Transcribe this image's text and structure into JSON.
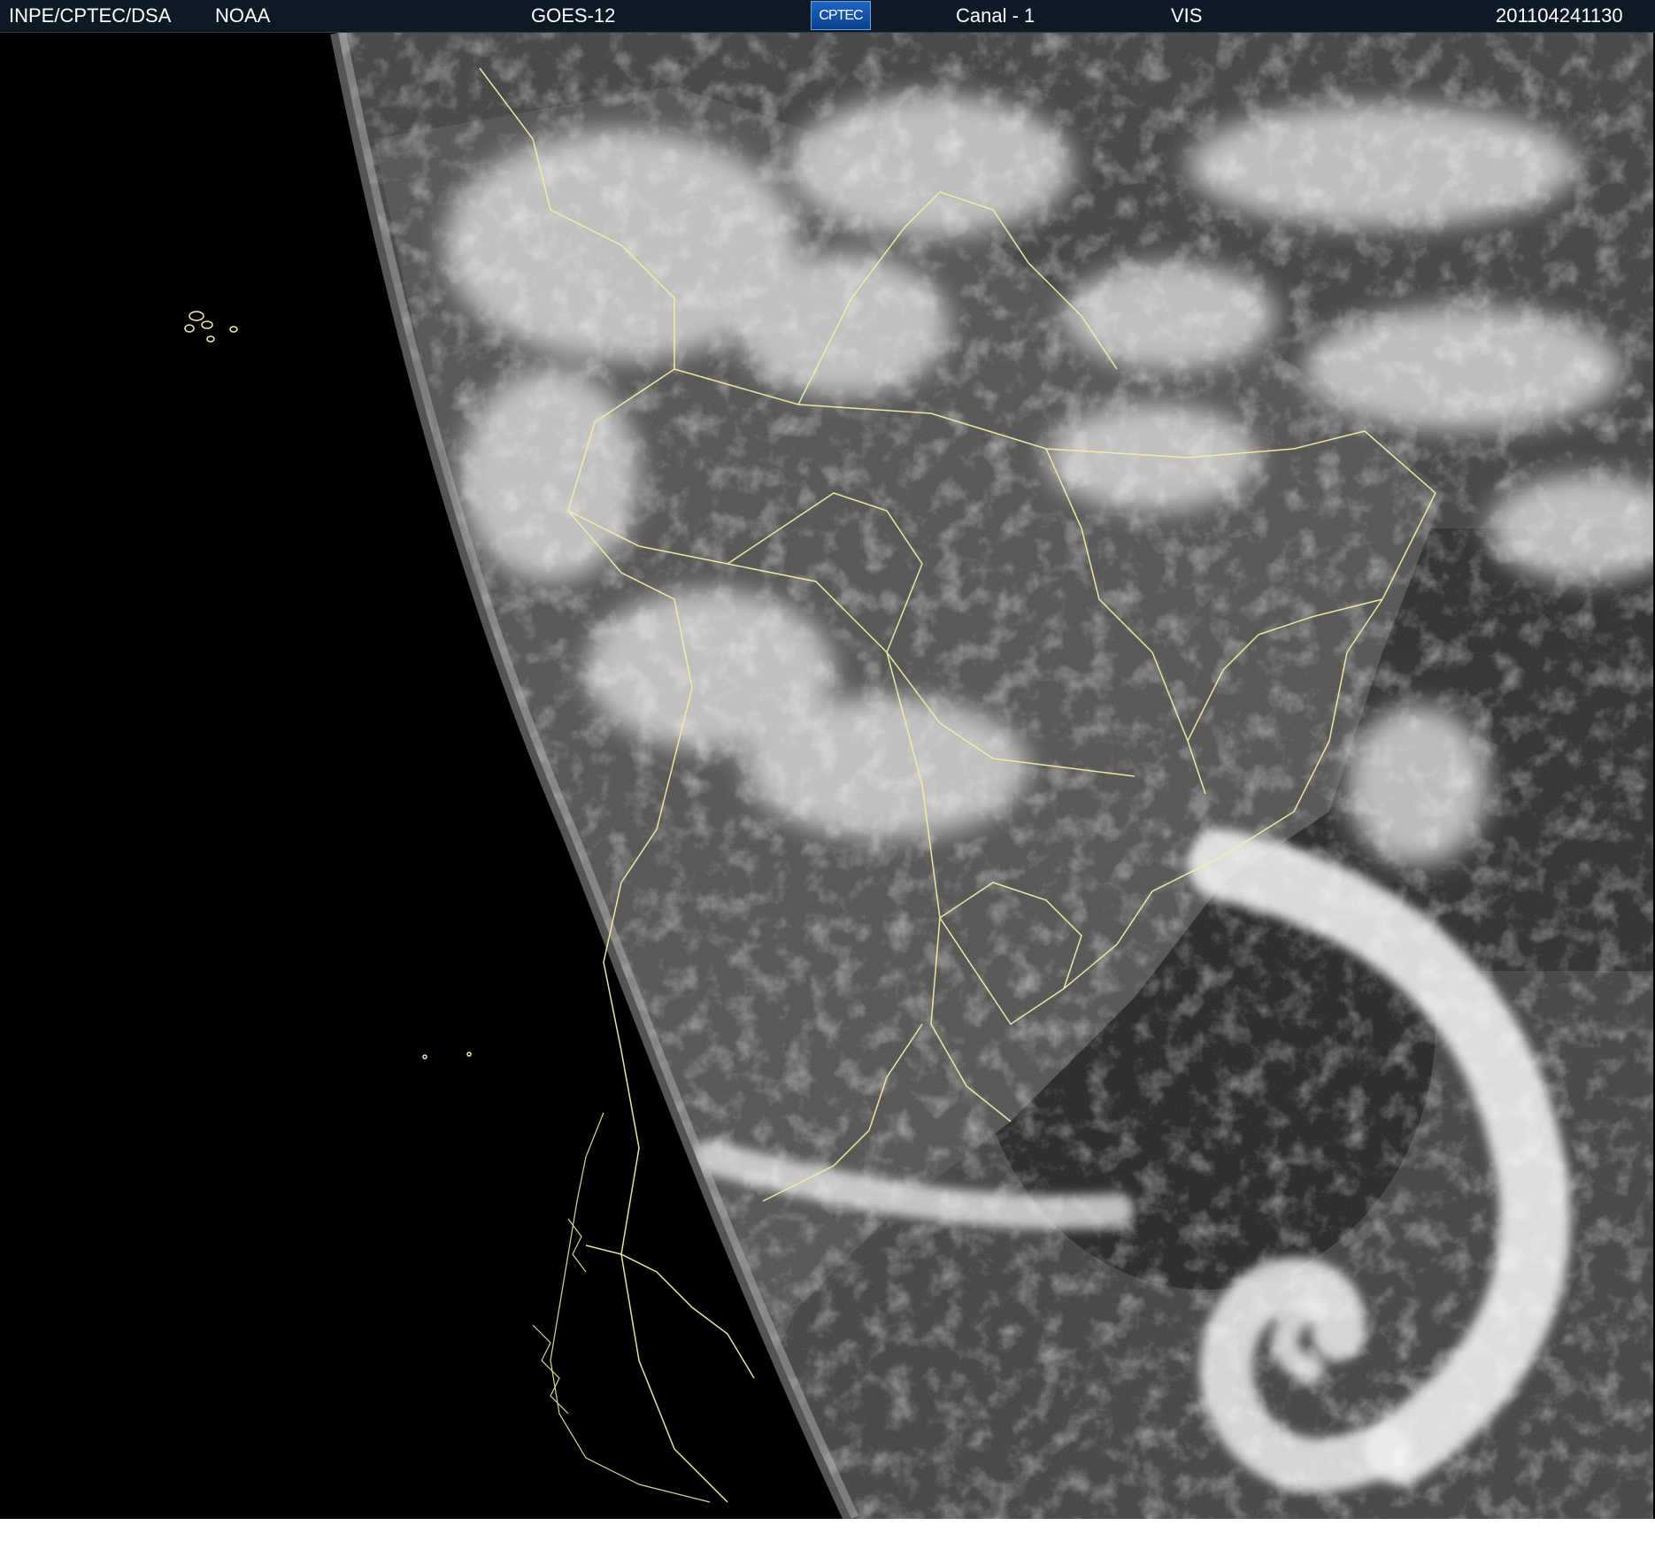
{
  "header": {
    "source": "INPE/CPTEC/DSA",
    "agency": "NOAA",
    "satellite": "GOES-12",
    "logo_text": "CPTEC",
    "channel": "Canal - 1",
    "band": "VIS",
    "timestamp": "201104241130"
  },
  "image": {
    "type": "satellite-visible-imagery",
    "icon": "satellite-earth-disk",
    "colors": {
      "space": "#000000",
      "ocean": "#2a2a2a",
      "cloud": "#e8e8e8",
      "borders": "#f3f0a6",
      "header": "#0d1a26"
    }
  }
}
